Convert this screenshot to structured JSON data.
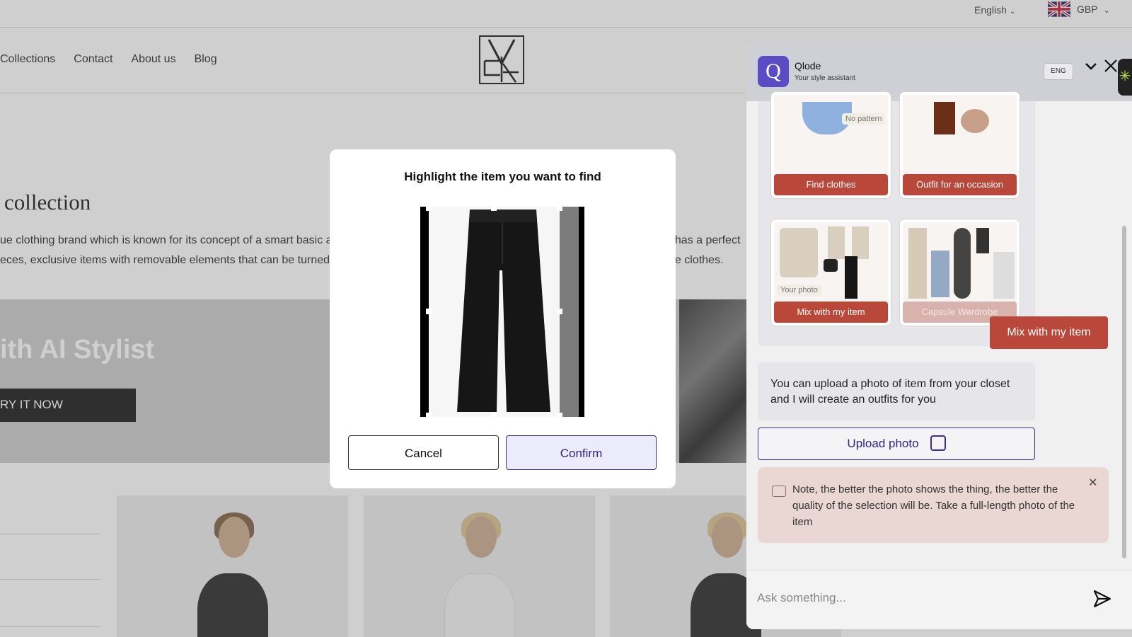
{
  "site": {
    "top": {
      "language": "English",
      "currency": "GBP"
    },
    "nav": [
      "Collections",
      "Contact",
      "About us",
      "Blog"
    ],
    "collection_title": "collection",
    "description_left": [
      "ue clothing brand which is known for its concept of a smart basic and",
      "eces, exclusive items with removable elements that can be turned fro"
    ],
    "description_right": [
      "t has a perfect",
      "ue clothes."
    ],
    "banner": {
      "title": "ith AI Stylist",
      "cta": "RY IT NOW"
    }
  },
  "modal": {
    "title": "Highlight the item you want to find",
    "cancel_label": "Cancel",
    "confirm_label": "Confirm"
  },
  "chat": {
    "name": "Qlode",
    "subtitle": "Your style assistant",
    "avatar_letter": "Q",
    "language_button": "ENG",
    "cards": [
      {
        "label": "Find clothes",
        "tag": "No pattern"
      },
      {
        "label": "Outfit for an occasion"
      },
      {
        "label": "Mix with my item",
        "tag": "Your photo"
      },
      {
        "label": "Capsule Wardrobe"
      }
    ],
    "user_message": "Mix with my item",
    "bot_message": "You can upload a photo of item from your closet and I will create an outfits for you",
    "upload_label": "Upload photo",
    "note": "Note, the better the photo shows the thing, the better the quality of the selection will be. Take a full-length photo of the item",
    "input_placeholder": "Ask something..."
  },
  "colors": {
    "brand": "#5b4bc4",
    "accent": "#b9483a",
    "confirm_border": "#3b2e9a"
  }
}
